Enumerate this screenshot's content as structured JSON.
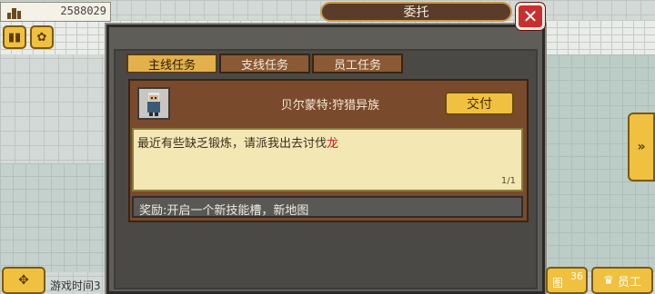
{
  "hud": {
    "gold_value": "2588029",
    "gold_icon": "building-icon",
    "pause_icon": "pause-icon",
    "speed_icon": "speed-icon",
    "move_icon": "dpad-icon",
    "game_time_label": "游戏时间3",
    "map_label": "图",
    "map_icon_text": "36",
    "staff_label": "员工",
    "staff_icon": "crown-icon",
    "side_arrow": "»"
  },
  "dialog": {
    "title": "委托",
    "close_icon": "close-icon",
    "tabs": [
      {
        "label": "主线任务",
        "active": true
      },
      {
        "label": "支线任务",
        "active": false
      },
      {
        "label": "员工任务",
        "active": false
      }
    ],
    "quest": {
      "name": "贝尔蒙特:狩猎异族",
      "submit_label": "交付",
      "description": "最近有些缺乏锻炼，请派我出去讨伐",
      "description_highlight": "龙",
      "page": "1/1",
      "reward": "奖励:开启一个新技能槽，新地图"
    }
  },
  "colors": {
    "accent_gold": "#f0c040",
    "tab_active": "#e2b14c",
    "card_brown": "#7a4a2c",
    "close_red": "#c83030",
    "highlight_red": "#d01a1a"
  }
}
